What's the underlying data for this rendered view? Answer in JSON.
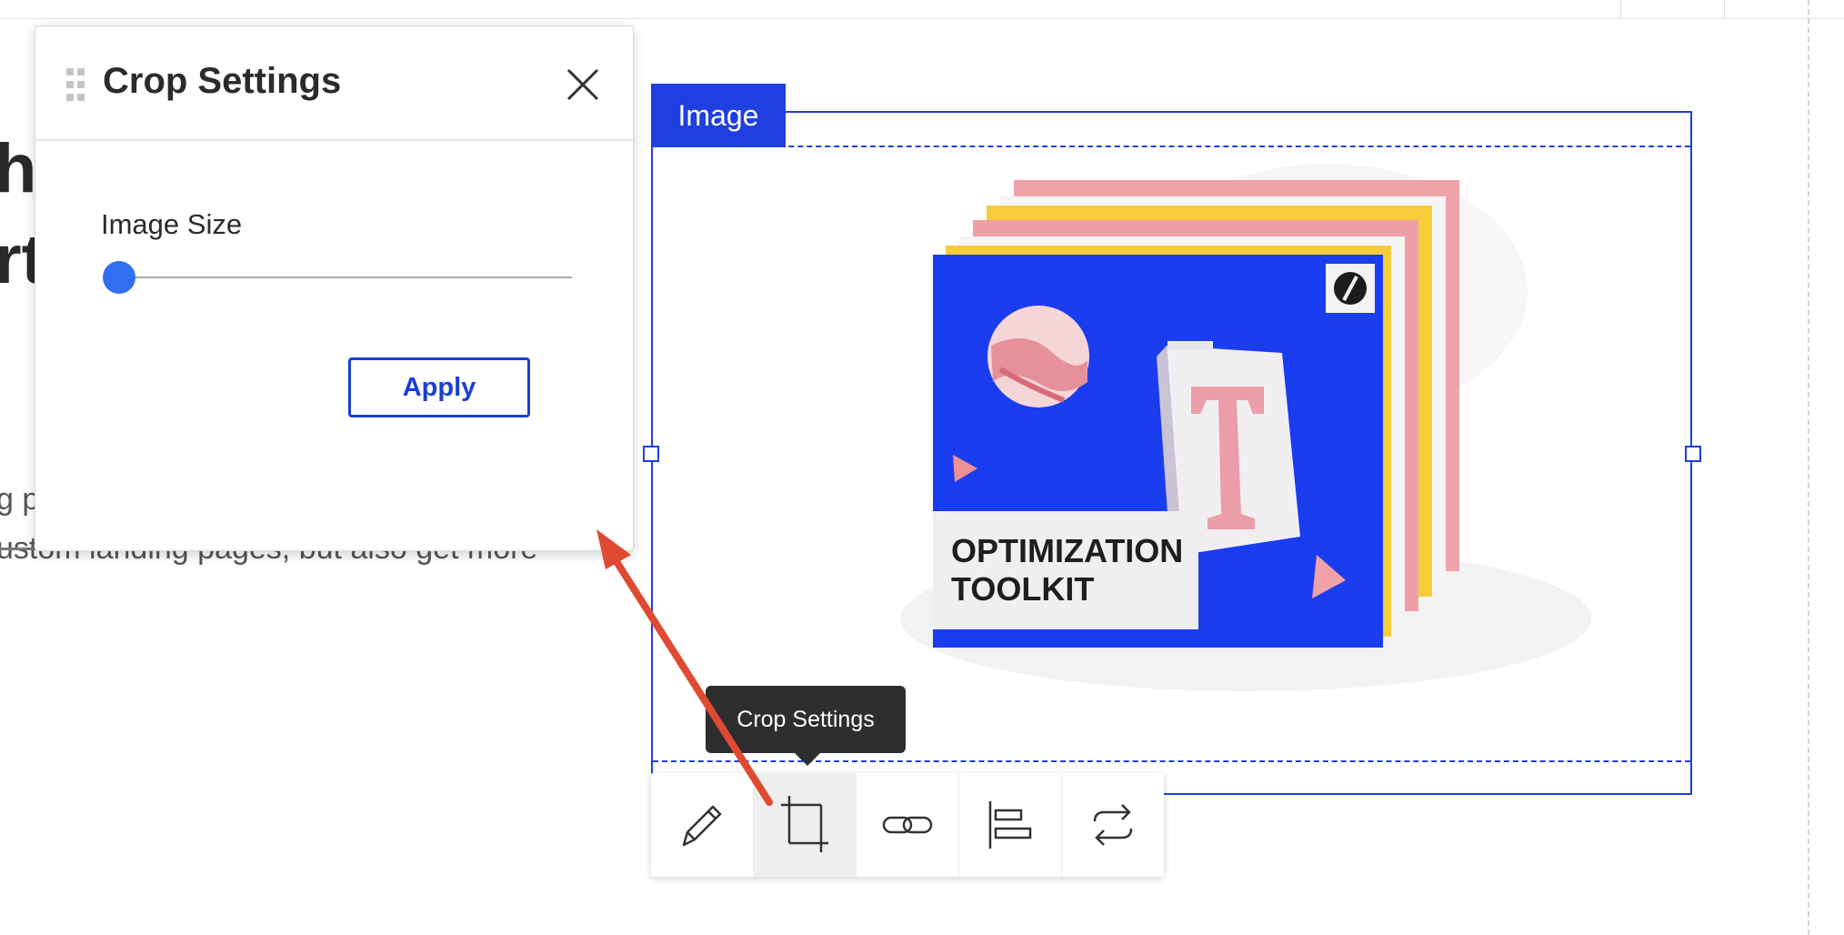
{
  "panel": {
    "title": "Crop Settings",
    "image_size_label": "Image Size",
    "image_size_value": 0,
    "apply_label": "Apply"
  },
  "background_text": {
    "heading_line1": "he",
    "heading_line2": "rt",
    "body_line1": "g p",
    "body_line2": "ustom landing pages, but also get more"
  },
  "widget": {
    "tag_label": "Image",
    "image_text_line1": "OPTIMIZATION",
    "image_text_line2": "TOOLKIT"
  },
  "tooltip": {
    "text": "Crop Settings"
  },
  "toolbar": {
    "items": [
      "pencil-icon",
      "crop-icon",
      "link-icon",
      "align-left-icon",
      "swap-icon"
    ],
    "active": "crop-icon"
  },
  "colors": {
    "accent": "#1f3fe0",
    "annotation_arrow": "#e04a33",
    "slider": "#2f6ff0"
  }
}
